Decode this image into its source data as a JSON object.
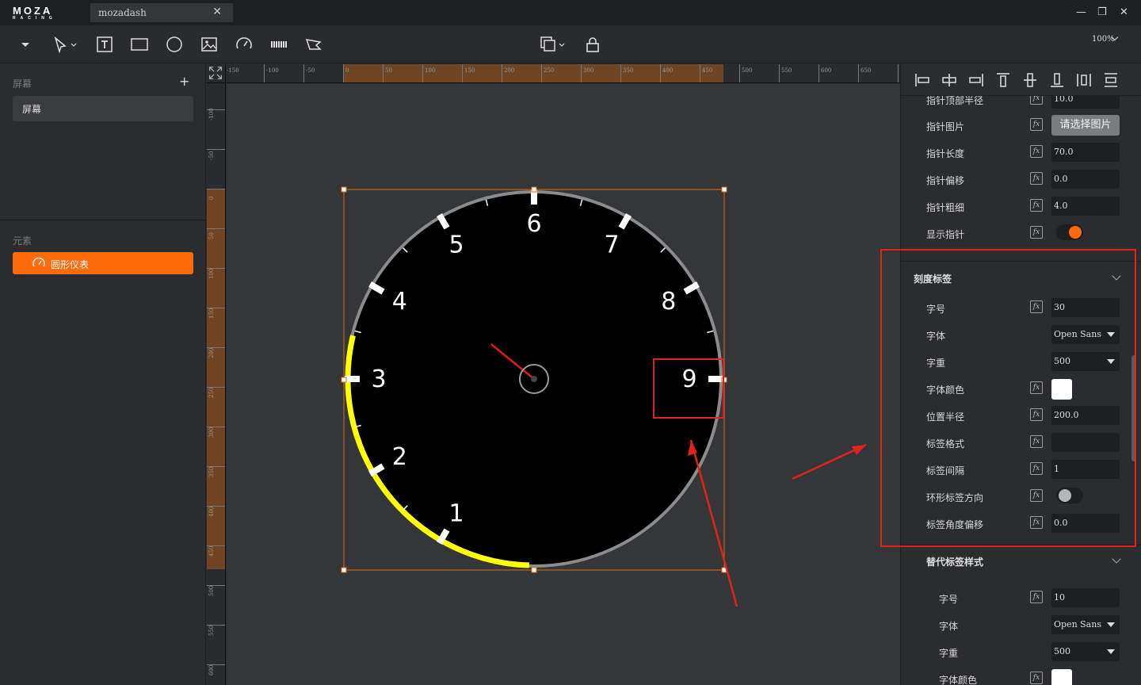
{
  "app": {
    "logo_main": "MOZA",
    "logo_sub": "RACING",
    "tab_title": "mozadash",
    "tab_close": "✕",
    "minimize": "—",
    "restore": "❐",
    "close": "✕"
  },
  "toolbar": {
    "zoom_label": "100%"
  },
  "left_panel": {
    "screens_title": "屏幕",
    "add_label": "+",
    "screen_item": "屏幕",
    "elements_title": "元素",
    "element_item": "圆形仪表"
  },
  "ruler": {
    "top_ticks": [
      "-150",
      "-100",
      "-50",
      "0",
      "50",
      "100",
      "150",
      "200",
      "250",
      "300",
      "350",
      "400",
      "450",
      "500",
      "550",
      "600",
      "650",
      "700"
    ],
    "left_ticks": [
      "-100",
      "-50",
      "0",
      "50",
      "100",
      "150",
      "200",
      "250",
      "300",
      "350",
      "400",
      "450",
      "500",
      "550",
      "600"
    ]
  },
  "gauge": {
    "tick_labels": [
      "1",
      "2",
      "3",
      "4",
      "5",
      "6",
      "7",
      "8",
      "9"
    ],
    "redline_from": 0,
    "redline_to": 3,
    "needle_value": 4.3,
    "colors": {
      "face": "#000000",
      "rim": "#8c8c8c",
      "highlight_arc": "#ffff00",
      "needle": "#e01b1b",
      "tick": "#ffffff",
      "selection": "#e06a14"
    }
  },
  "properties_top": [
    {
      "label": "指针顶部半径",
      "type": "input",
      "value": "10.0"
    },
    {
      "label": "指针图片",
      "type": "button",
      "value": "请选择图片"
    },
    {
      "label": "指针长度",
      "type": "input",
      "value": "70.0"
    },
    {
      "label": "指针偏移",
      "type": "input",
      "value": "0.0"
    },
    {
      "label": "指针粗细",
      "type": "input",
      "value": "4.0"
    },
    {
      "label": "显示指针",
      "type": "toggle",
      "on": true
    }
  ],
  "tick_label_group": {
    "title": "刻度标签",
    "rows": [
      {
        "label": "字号",
        "type": "input",
        "value": "30",
        "fx": true
      },
      {
        "label": "字体",
        "type": "select",
        "value": "Open Sans",
        "fx": false
      },
      {
        "label": "字重",
        "type": "select",
        "value": "500",
        "fx": false
      },
      {
        "label": "字体颜色",
        "type": "color",
        "value": "#ffffff",
        "fx": true
      },
      {
        "label": "位置半径",
        "type": "input",
        "value": "200.0",
        "fx": true
      },
      {
        "label": "标签格式",
        "type": "input",
        "value": "",
        "fx": true
      },
      {
        "label": "标签间隔",
        "type": "input",
        "value": "1",
        "fx": true
      },
      {
        "label": "环形标签方向",
        "type": "toggle",
        "on": false,
        "fx": true
      },
      {
        "label": "标签角度偏移",
        "type": "input",
        "value": "0.0",
        "fx": true
      }
    ]
  },
  "alt_label_group": {
    "title": "替代标签样式",
    "rows": [
      {
        "label": "字号",
        "type": "input",
        "value": "10",
        "fx": true
      },
      {
        "label": "字体",
        "type": "select",
        "value": "Open Sans",
        "fx": false
      },
      {
        "label": "字重",
        "type": "select",
        "value": "500",
        "fx": false
      },
      {
        "label": "字体颜色",
        "type": "color",
        "value": "#ffffff",
        "fx": true
      }
    ]
  },
  "fx_label": "fx"
}
